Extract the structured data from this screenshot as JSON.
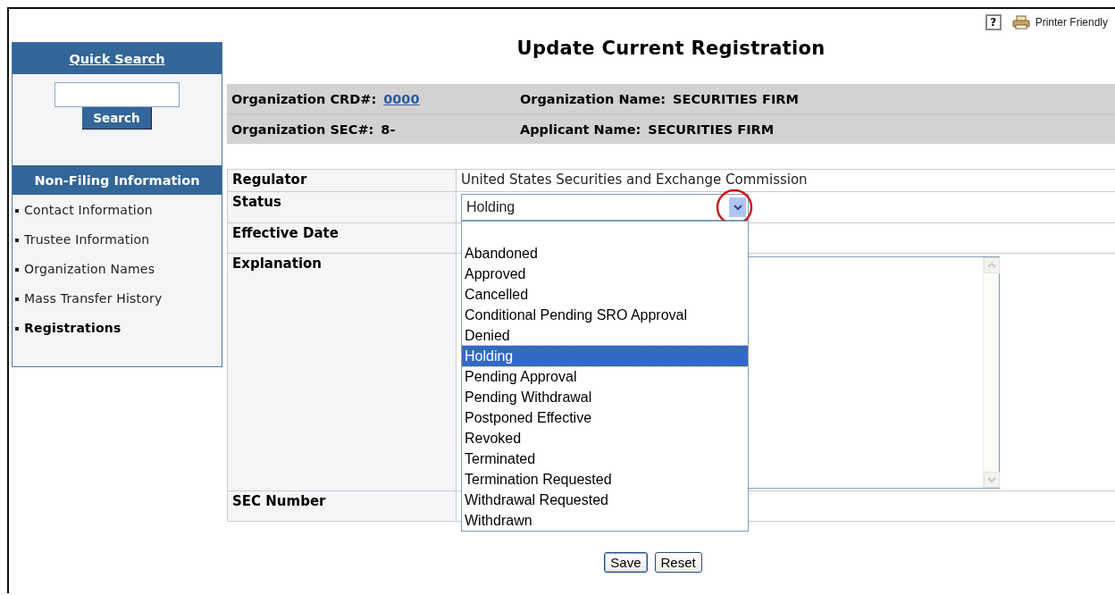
{
  "toolbar": {
    "help": "?",
    "printer_friendly": "Printer Friendly"
  },
  "title": "Update Current Registration",
  "sidebar": {
    "quick_search": {
      "title": "Quick Search",
      "button": "Search"
    },
    "section_title": "Non-Filing Information",
    "items": [
      {
        "label": "Contact Information",
        "selected": false
      },
      {
        "label": "Trustee Information",
        "selected": false
      },
      {
        "label": "Organization Names",
        "selected": false
      },
      {
        "label": "Mass Transfer History",
        "selected": false
      },
      {
        "label": "Registrations",
        "selected": true
      }
    ]
  },
  "header": {
    "rows": [
      [
        {
          "label": "Organization CRD#:",
          "value": "0000",
          "kind": "link"
        },
        {
          "label": "Organization Name:",
          "value": "SECURITIES FIRM",
          "kind": "text"
        }
      ],
      [
        {
          "label": "Organization SEC#:",
          "value": "8-",
          "kind": "text"
        },
        {
          "label": "Applicant Name:",
          "value": "SECURITIES FIRM",
          "kind": "text"
        }
      ]
    ]
  },
  "form": {
    "rows": [
      {
        "label": "Regulator",
        "kind": "text",
        "value": "United States Securities and Exchange Commission"
      },
      {
        "label": "Status",
        "kind": "select",
        "value": "Holding",
        "expanded": true
      },
      {
        "label": "Effective Date",
        "kind": "empty"
      },
      {
        "label": "Explanation",
        "kind": "textarea"
      },
      {
        "label": "SEC Number",
        "kind": "empty"
      }
    ]
  },
  "status_options": [
    {
      "label": "Abandoned",
      "selected": false
    },
    {
      "label": "Approved",
      "selected": false
    },
    {
      "label": "Cancelled",
      "selected": false
    },
    {
      "label": "Conditional Pending SRO Approval",
      "selected": false
    },
    {
      "label": "Denied",
      "selected": false
    },
    {
      "label": "Holding",
      "selected": true
    },
    {
      "label": "Pending Approval",
      "selected": false
    },
    {
      "label": "Pending Withdrawal",
      "selected": false
    },
    {
      "label": "Postponed Effective",
      "selected": false
    },
    {
      "label": "Revoked",
      "selected": false
    },
    {
      "label": "Terminated",
      "selected": false
    },
    {
      "label": "Termination Requested",
      "selected": false
    },
    {
      "label": "Withdrawal Requested",
      "selected": false
    },
    {
      "label": "Withdrawn",
      "selected": false
    }
  ],
  "buttons": [
    "Save",
    "Reset"
  ]
}
